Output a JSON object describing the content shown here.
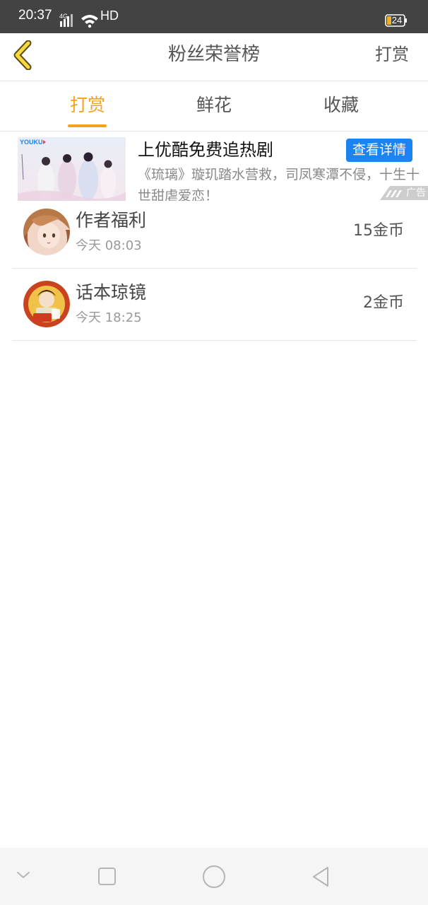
{
  "status_bar": {
    "time": "20:37",
    "network": "4G",
    "hd": "HD",
    "battery": "24"
  },
  "header": {
    "title": "粉丝荣誉榜",
    "action": "打赏",
    "back_icon": "back-chevron-icon"
  },
  "tabs": [
    {
      "label": "打赏",
      "active": true
    },
    {
      "label": "鲜花",
      "active": false
    },
    {
      "label": "收藏",
      "active": false
    }
  ],
  "ad": {
    "brand": "YOUKU",
    "title": "上优酷免费追热剧",
    "button": "查看详情",
    "description": "《琉璃》璇玑踏水营救，司凤寒潭不侵，十生十世甜虐爱恋！",
    "tag": "广告"
  },
  "list": [
    {
      "name": "作者福利",
      "time": "今天 08:03",
      "amount": "15金币"
    },
    {
      "name": "话本琼镜",
      "time": "今天 18:25",
      "amount": "2金币"
    }
  ],
  "colors": {
    "accent": "#f3a21e",
    "ad_button": "#1c83f3"
  }
}
